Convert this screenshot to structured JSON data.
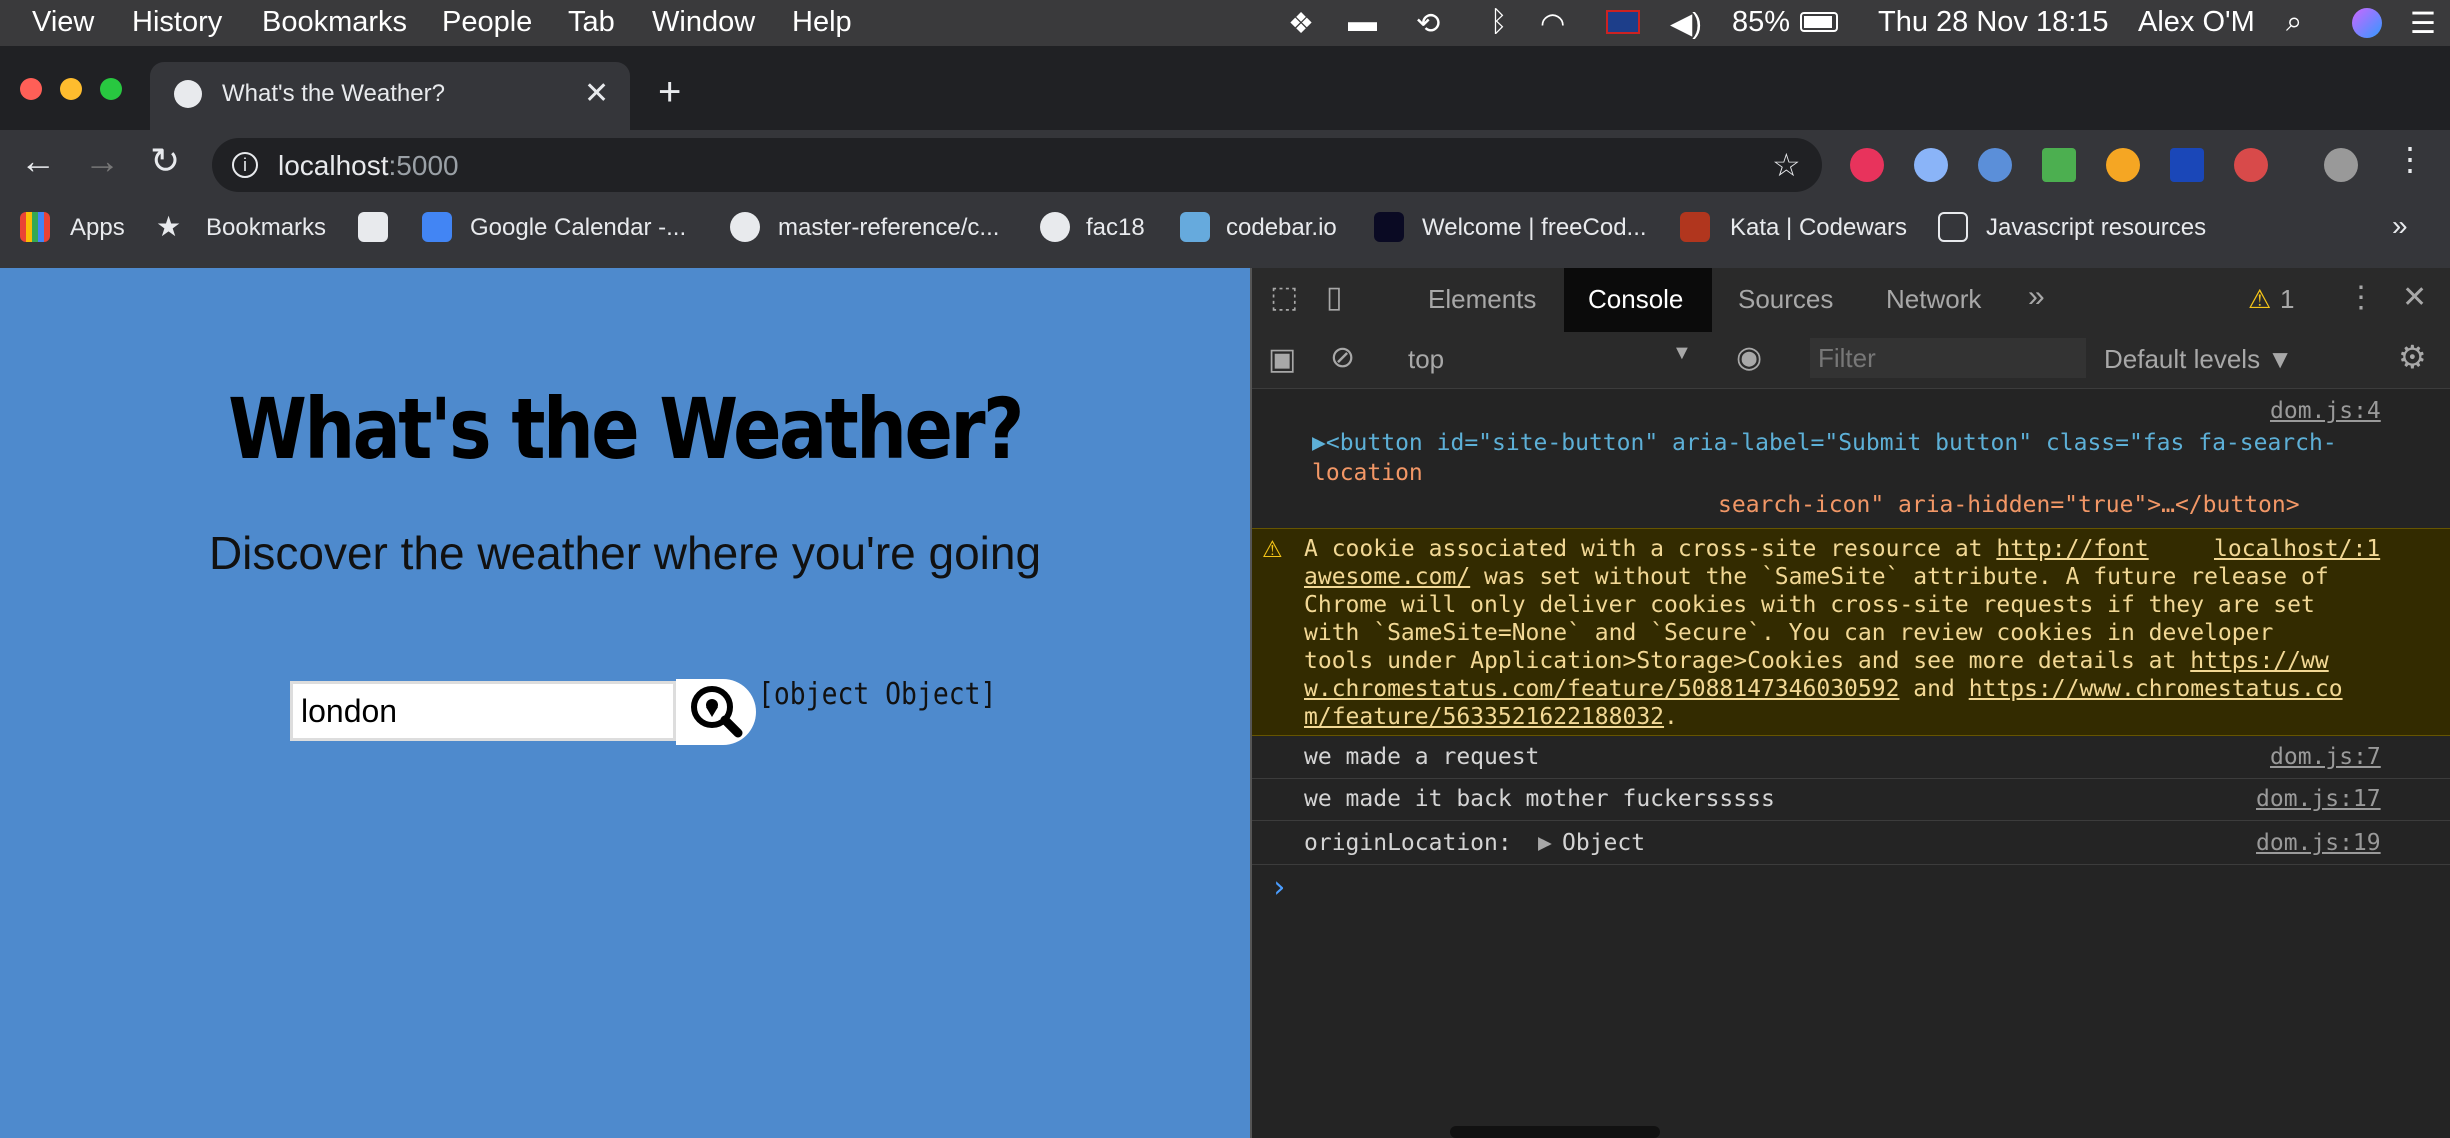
{
  "menubar": {
    "items": [
      "View",
      "History",
      "Bookmarks",
      "People",
      "Tab",
      "Window",
      "Help"
    ],
    "battery": "85%",
    "datetime": "Thu 28 Nov  18:15",
    "user": "Alex O'M"
  },
  "tab": {
    "title": "What's the Weather?"
  },
  "omnibox": {
    "host": "localhost",
    "port": ":5000"
  },
  "bookmarks": [
    "Apps",
    "Bookmarks",
    "",
    "Google Calendar -...",
    "master-reference/c...",
    "fac18",
    "codebar.io",
    "Welcome | freeCod...",
    "Kata | Codewars",
    "Javascript resources"
  ],
  "page": {
    "title": "What's the Weather?",
    "subtitle": "Discover the weather where you're going",
    "input_value": "london",
    "result": "[object Object]"
  },
  "devtools": {
    "tabs": [
      "Elements",
      "Console",
      "Sources",
      "Network"
    ],
    "warning_count": "1",
    "context": "top",
    "filter_placeholder": "Filter",
    "levels": "Default levels ▼",
    "logs": [
      {
        "src": "dom.js:4"
      },
      {
        "src": "dom.js:7",
        "text": "we made a request"
      },
      {
        "src": "dom.js:17",
        "text": "we made it back mother fuckersssss"
      },
      {
        "src": "dom.js:19",
        "text": "originLocation: ",
        "obj": "Object"
      }
    ],
    "element_line1": "▶<button id=\"site-button\" aria-label=\"Submit button\" class=\"fas fa-search-",
    "element_line2": "location",
    "element_line3": "search-icon\" aria-hidden=\"true\">…</button>",
    "warning": {
      "l1": "A cookie associated with a cross-site resource at ",
      "l1link": "http://font",
      "l1src": "localhost/:1",
      "l2link": "awesome.com/",
      "l2": " was set without the `SameSite` attribute. A future release of",
      "l3": "Chrome will only deliver cookies with cross-site requests if they are set",
      "l4": "with `SameSite=None` and `Secure`. You can review cookies in developer",
      "l5": "tools under Application>Storage>Cookies and see more details at ",
      "l5link": "https://ww",
      "l6link": "w.chromestatus.com/feature/5088147346030592",
      "l6": " and ",
      "l6link2": "https://www.chromestatus.co",
      "l7link": "m/feature/5633521622188032",
      "l7": "."
    },
    "prompt": "›"
  }
}
